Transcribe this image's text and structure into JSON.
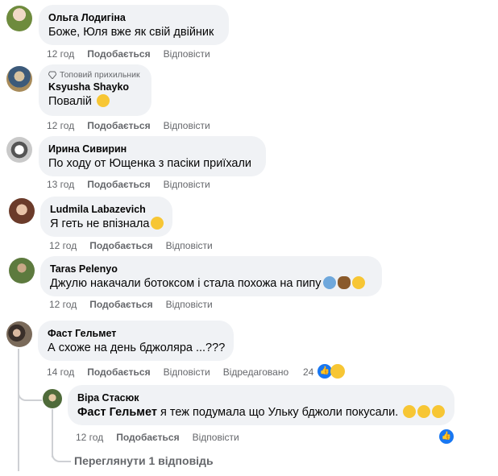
{
  "comments": [
    {
      "author": "Ольга Лодигіна",
      "text": "Боже, Юля вже як свій двійник",
      "time": "12 год",
      "like": "Подобається",
      "reply": "Відповісти"
    },
    {
      "badge": "Топовий прихильник",
      "author": "Ksyusha Shayko",
      "text": "Повалій",
      "time": "12 год",
      "like": "Подобається",
      "reply": "Відповісти"
    },
    {
      "author": "Ирина Сивирин",
      "text": "По ходу от Ющенка з пасіки приїхали",
      "time": "13 год",
      "like": "Подобається",
      "reply": "Відповісти"
    },
    {
      "author": "Ludmila Labazevich",
      "text": "Я геть не впізнала",
      "time": "12 год",
      "like": "Подобається",
      "reply": "Відповісти"
    },
    {
      "author": "Taras Pelenyo",
      "text": "Джулю накачали ботоксом і стала похожа на пипу",
      "time": "12 год",
      "like": "Подобається",
      "reply": "Відповісти"
    },
    {
      "author": "Фаст Гельмет",
      "text": "А схоже на день бджоляра ...???",
      "time": "14 год",
      "like": "Подобається",
      "reply": "Відповісти",
      "edited": "Відредаговано",
      "reaction_count": "24"
    }
  ],
  "reply": {
    "author": "Віра Стасюк",
    "mention": "Фаст Гельмет",
    "text": "я теж подумала що Ульку бджоли покусали.",
    "time": "12 год",
    "like": "Подобається",
    "reply": "Відповісти"
  },
  "view_replies": "Переглянути 1 відповідь",
  "colors": {
    "bubble": "#f0f2f5",
    "meta": "#65676b",
    "like_blue": "#1877f2",
    "emoji_yellow": "#f7c634"
  },
  "icons": [
    "diamond-icon",
    "like-reaction-icon",
    "haha-reaction-icon"
  ]
}
